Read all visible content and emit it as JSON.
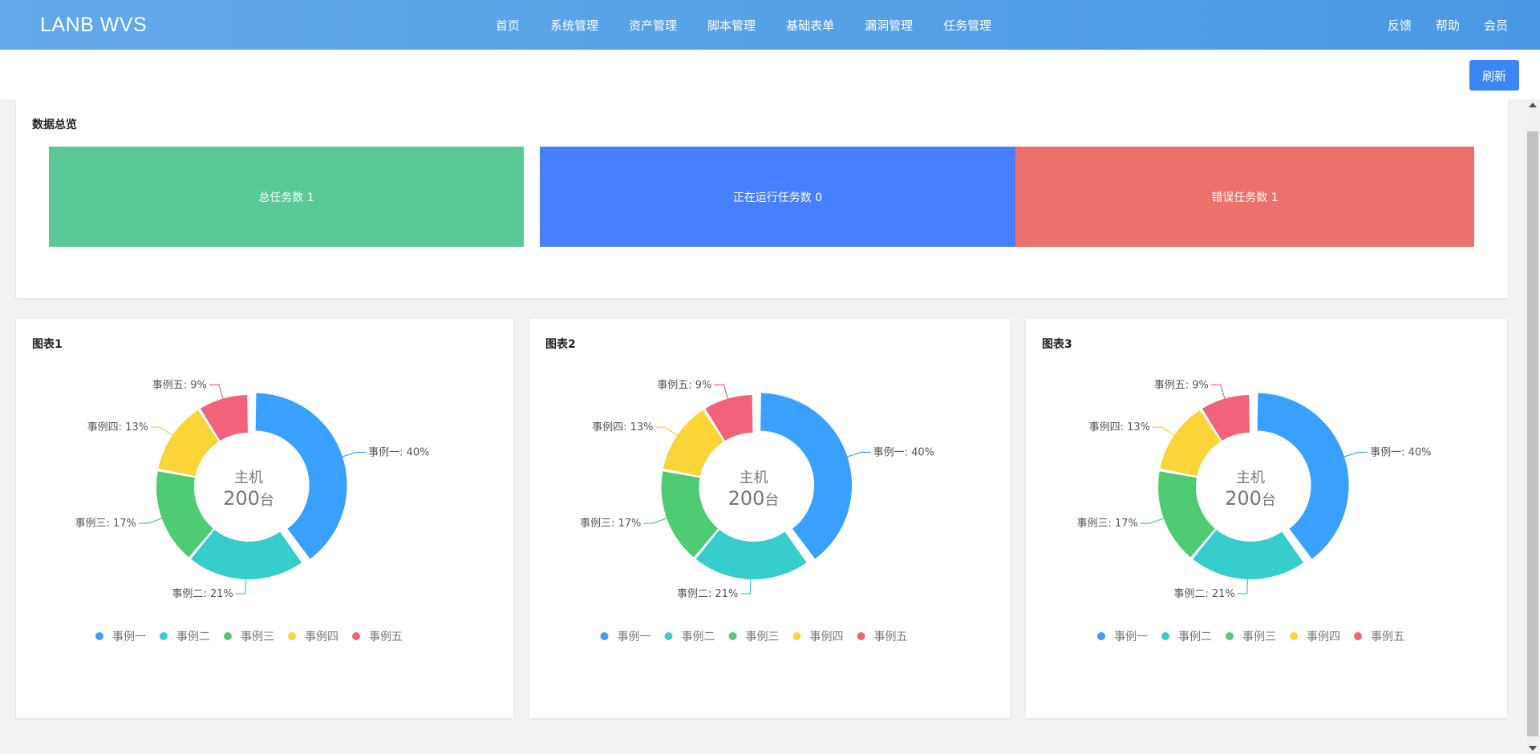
{
  "app": {
    "brand": "LANB WVS"
  },
  "nav": {
    "main": [
      "首页",
      "系统管理",
      "资产管理",
      "脚本管理",
      "基础表单",
      "漏洞管理",
      "任务管理"
    ],
    "right": [
      "反馈",
      "帮助",
      "会员"
    ]
  },
  "toolbar": {
    "refresh_label": "刷新"
  },
  "overview": {
    "title": "数据总览",
    "stats": [
      {
        "label": "总任务数 1",
        "color": "#58c997"
      },
      {
        "label": "正在运行任务数 0",
        "color": "#4680fe"
      },
      {
        "label": "错误任务数 1",
        "color": "#ed706c"
      }
    ]
  },
  "chart_data": [
    {
      "type": "pie",
      "title": "图表1",
      "center_label": "主机",
      "center_value": "200",
      "center_unit": "台",
      "categories": [
        "事例一",
        "事例二",
        "事例三",
        "事例四",
        "事例五"
      ],
      "values": [
        40,
        21,
        17,
        13,
        9
      ],
      "value_labels": [
        "事例一: 40%",
        "事例二: 21%",
        "事例三: 17%",
        "事例四: 13%",
        "事例五: 9%"
      ],
      "colors": [
        "#3aa0fd",
        "#37cdcc",
        "#4fcb73",
        "#fbd437",
        "#f2637b"
      ],
      "legend": "bottom"
    },
    {
      "type": "pie",
      "title": "图表2",
      "center_label": "主机",
      "center_value": "200",
      "center_unit": "台",
      "categories": [
        "事例一",
        "事例二",
        "事例三",
        "事例四",
        "事例五"
      ],
      "values": [
        40,
        21,
        17,
        13,
        9
      ],
      "value_labels": [
        "事例一: 40%",
        "事例二: 21%",
        "事例三: 17%",
        "事例四: 13%",
        "事例五: 9%"
      ],
      "colors": [
        "#3aa0fd",
        "#37cdcc",
        "#4fcb73",
        "#fbd437",
        "#f2637b"
      ],
      "legend": "bottom"
    },
    {
      "type": "pie",
      "title": "图表3",
      "center_label": "主机",
      "center_value": "200",
      "center_unit": "台",
      "categories": [
        "事例一",
        "事例二",
        "事例三",
        "事例四",
        "事例五"
      ],
      "values": [
        40,
        21,
        17,
        13,
        9
      ],
      "value_labels": [
        "事例一: 40%",
        "事例二: 21%",
        "事例三: 17%",
        "事例四: 13%",
        "事例五: 9%"
      ],
      "colors": [
        "#3aa0fd",
        "#37cdcc",
        "#4fcb73",
        "#fbd437",
        "#f2637b"
      ],
      "legend": "bottom"
    }
  ]
}
